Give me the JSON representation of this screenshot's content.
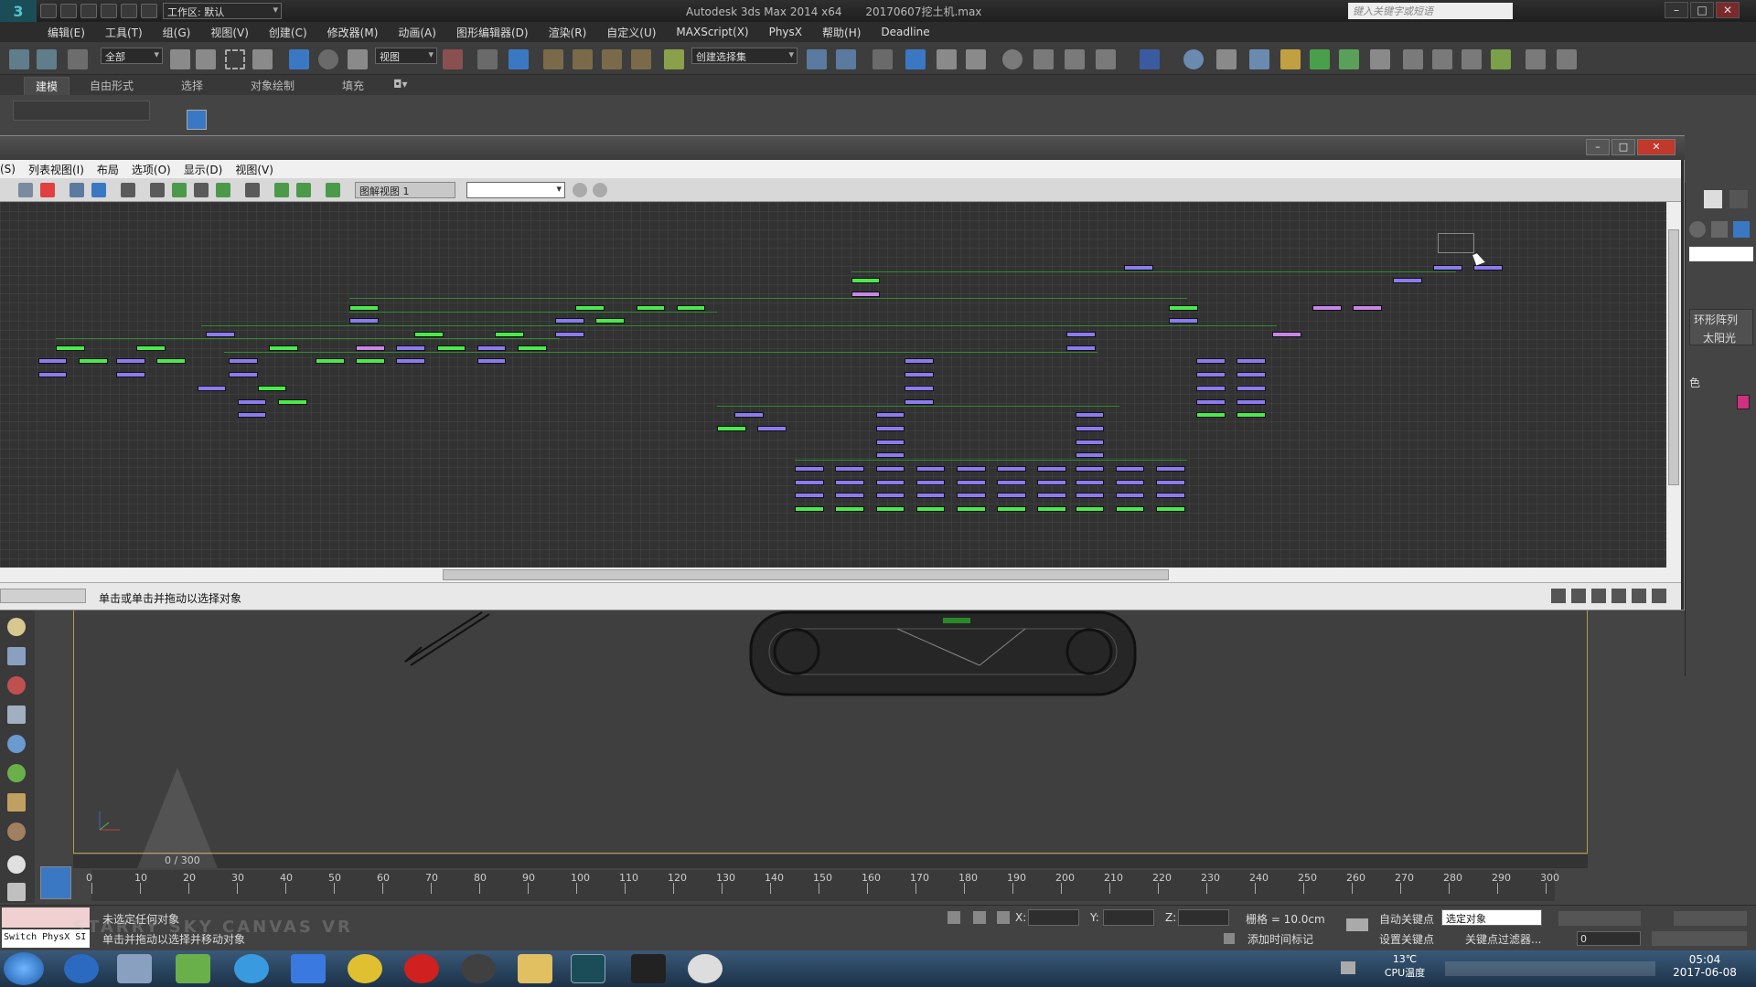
{
  "titlebar": {
    "workspace": "工作区: 默认",
    "app_title": "Autodesk 3ds Max  2014 x64",
    "file_title": "20170607挖土机.max",
    "help_placeholder": "键入关键字或短语"
  },
  "menu": [
    "编辑(E)",
    "工具(T)",
    "组(G)",
    "视图(V)",
    "创建(C)",
    "修改器(M)",
    "动画(A)",
    "图形编辑器(D)",
    "渲染(R)",
    "自定义(U)",
    "MAXScript(X)",
    "PhysX",
    "帮助(H)",
    "Deadline"
  ],
  "toolbar": {
    "filter_value": "全部",
    "coord_value": "视图",
    "selection_set": "创建选择集"
  },
  "ribbon": {
    "tabs": [
      "建模",
      "自由形式",
      "选择",
      "对象绘制",
      "填充"
    ]
  },
  "schematic": {
    "menu": [
      "(S)",
      "列表视图(I)",
      "布局",
      "选项(O)",
      "显示(D)",
      "视图(V)"
    ],
    "view_name": "图解视图 1",
    "status": "单击或单击并拖动以选择对象"
  },
  "command_panel": {
    "labels": [
      "环形阵列",
      "太阳光",
      "色"
    ]
  },
  "timeline": {
    "frame": "0 / 300",
    "ticks": [
      "0",
      "10",
      "20",
      "30",
      "40",
      "50",
      "60",
      "70",
      "80",
      "90",
      "100",
      "110",
      "120",
      "130",
      "140",
      "150",
      "160",
      "170",
      "180",
      "190",
      "200",
      "210",
      "220",
      "230",
      "240",
      "250",
      "260",
      "270",
      "280",
      "290",
      "300"
    ]
  },
  "statusbar": {
    "script_label": "Switch PhysX SI",
    "status_line1": "未选定任何对象",
    "status_line2": "单击并拖动以选择并移动对象",
    "x_label": "X:",
    "y_label": "Y:",
    "z_label": "Z:",
    "grid": "栅格 = 10.0cm",
    "add_time_tag": "添加时间标记",
    "auto_key": "自动关键点",
    "set_key": "设置关键点",
    "selection_value": "选定对象",
    "key_filter": "关键点过滤器...",
    "frame_field": "0"
  },
  "taskbar": {
    "temp": "13℃",
    "temp_label": "CPU温度",
    "time": "05:04",
    "date": "2017-06-08"
  },
  "watermark": "STARRY SKY CANVAS VR",
  "colors": {
    "node_blue": "#8c7bf0",
    "node_green": "#4bea4b",
    "node_pink": "#c887e8",
    "accent": "#1b4d58"
  }
}
